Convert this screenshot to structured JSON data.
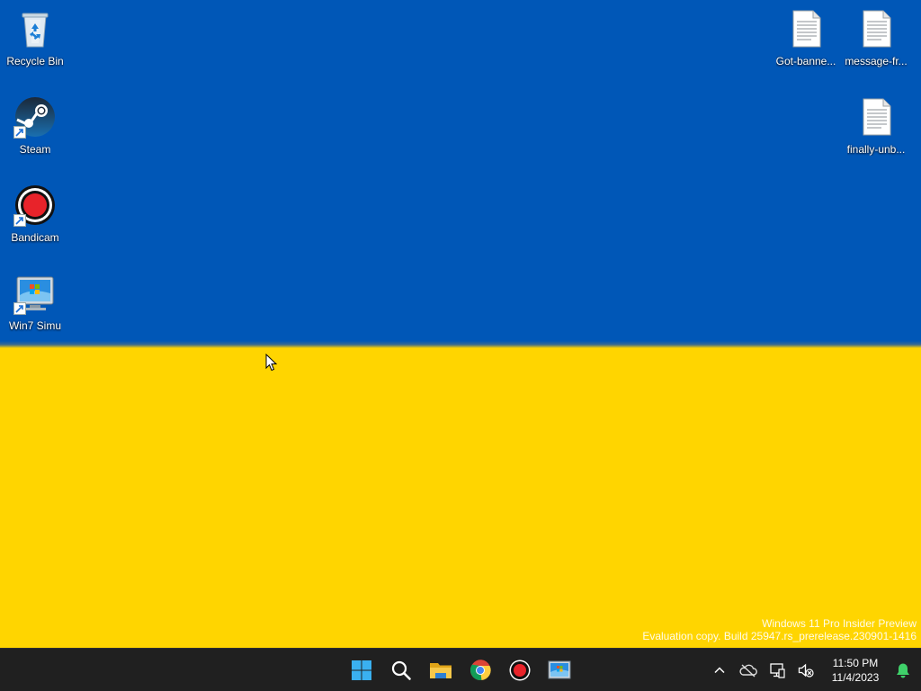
{
  "desktop": {
    "colors": {
      "flag_blue": "#0057b7",
      "flag_yellow": "#ffd500"
    },
    "icons_left": [
      {
        "label": "Recycle Bin",
        "icon": "recycle-bin-icon"
      },
      {
        "label": "Steam",
        "icon": "steam-icon",
        "shortcut": true
      },
      {
        "label": "Bandicam",
        "icon": "bandicam-icon",
        "shortcut": true
      },
      {
        "label": "Win7 Simu",
        "icon": "win7-simu-icon",
        "shortcut": true
      }
    ],
    "icons_right": [
      {
        "label": "Got-banne...",
        "icon": "text-document-icon"
      },
      {
        "label": "message-fr...",
        "icon": "text-document-icon"
      },
      {
        "label": "finally-unb...",
        "icon": "text-document-icon"
      }
    ],
    "watermark": {
      "line1": "Windows 11 Pro Insider Preview",
      "line2": "Evaluation copy. Build 25947.rs_prerelease.230901-1416"
    }
  },
  "taskbar": {
    "pinned": [
      {
        "name": "start-button",
        "icon": "windows-logo-icon"
      },
      {
        "name": "search-button",
        "icon": "search-icon"
      },
      {
        "name": "file-explorer-button",
        "icon": "folder-icon"
      },
      {
        "name": "chrome-button",
        "icon": "chrome-icon"
      },
      {
        "name": "bandicam-taskbar-button",
        "icon": "record-icon"
      },
      {
        "name": "win7-simu-taskbar-button",
        "icon": "win7-simu-icon"
      }
    ],
    "tray": {
      "icons": [
        "chevron-up-icon",
        "onedrive-offline-icon",
        "network-icon",
        "volume-muted-icon"
      ],
      "time": "11:50 PM",
      "date": "11/4/2023",
      "notification_icon": "bell-icon"
    }
  }
}
